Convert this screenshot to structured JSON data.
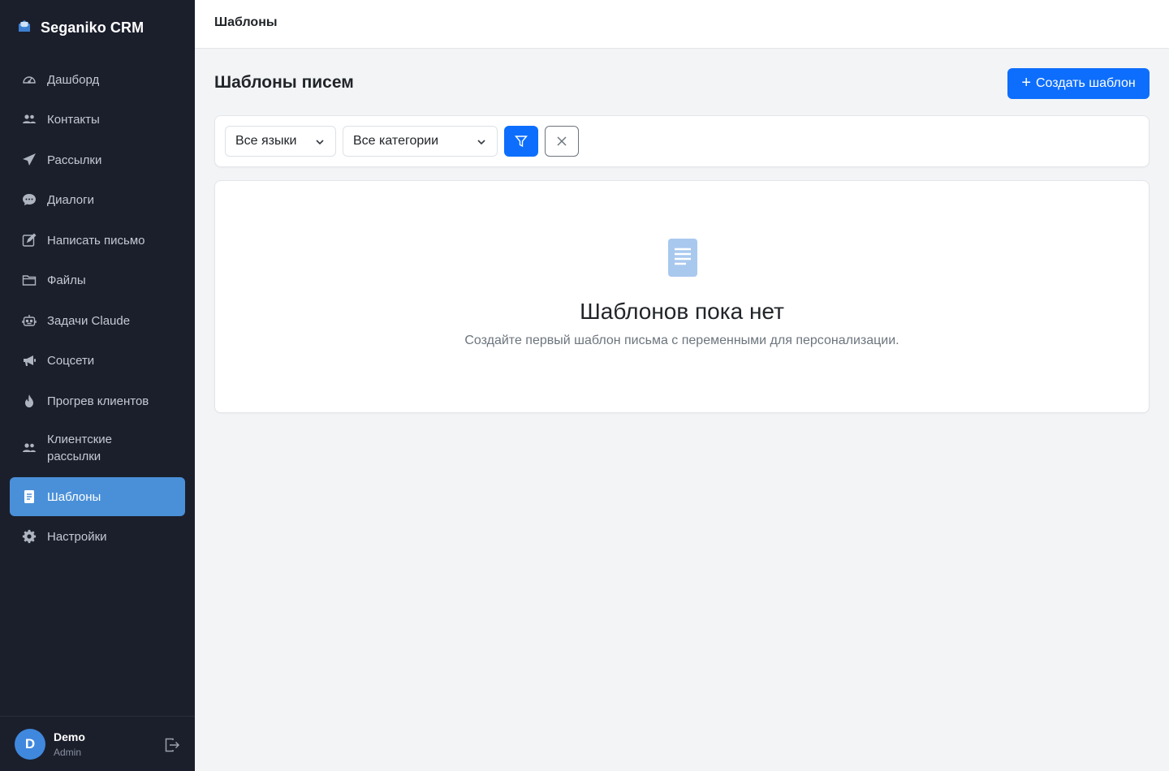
{
  "app": {
    "name": "Seganiko CRM"
  },
  "header": {
    "breadcrumb": "Шаблоны"
  },
  "sidebar": {
    "items": [
      {
        "label": "Дашборд",
        "icon": "speedometer-icon",
        "active": false
      },
      {
        "label": "Контакты",
        "icon": "people-icon",
        "active": false
      },
      {
        "label": "Рассылки",
        "icon": "send-icon",
        "active": false
      },
      {
        "label": "Диалоги",
        "icon": "chat-icon",
        "active": false
      },
      {
        "label": "Написать письмо",
        "icon": "pencil-square-icon",
        "active": false
      },
      {
        "label": "Файлы",
        "icon": "folder-icon",
        "active": false
      },
      {
        "label": "Задачи Claude",
        "icon": "robot-icon",
        "active": false
      },
      {
        "label": "Соцсети",
        "icon": "megaphone-icon",
        "active": false
      },
      {
        "label": "Прогрев клиентов",
        "icon": "fire-icon",
        "active": false
      },
      {
        "label": "Клиентские рассылки",
        "icon": "people-icon",
        "active": false
      },
      {
        "label": "Шаблоны",
        "icon": "file-text-icon",
        "active": true
      },
      {
        "label": "Настройки",
        "icon": "gear-icon",
        "active": false
      }
    ]
  },
  "user": {
    "initial": "D",
    "name": "Demo",
    "role": "Admin"
  },
  "main": {
    "title": "Шаблоны писем",
    "create_label": "Создать шаблон",
    "filters": {
      "language": "Все языки",
      "category": "Все категории"
    },
    "empty": {
      "title": "Шаблонов пока нет",
      "subtitle": "Создайте первый шаблон письма с переменными для персонализации."
    }
  },
  "colors": {
    "sidebar_bg": "#1b1f2c",
    "active_item": "#4a90d9",
    "primary": "#0d6efd",
    "page_bg": "#f3f4f6"
  }
}
